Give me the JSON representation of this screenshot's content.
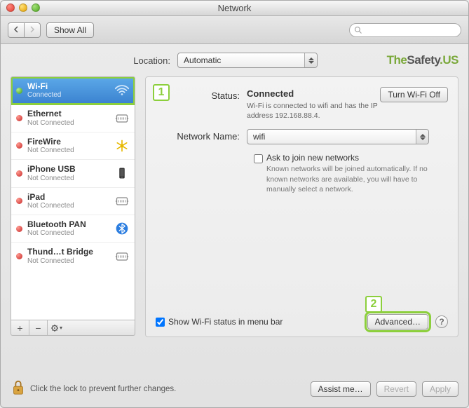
{
  "window": {
    "title": "Network"
  },
  "toolbar": {
    "show_all": "Show All",
    "search_placeholder": ""
  },
  "brand": {
    "the": "The",
    "safety": "Safety",
    "us": ".US"
  },
  "location": {
    "label": "Location:",
    "value": "Automatic"
  },
  "sidebar": {
    "items": [
      {
        "name": "Wi-Fi",
        "status": "Connected",
        "dot": "green",
        "icon": "wifi",
        "selected": true
      },
      {
        "name": "Ethernet",
        "status": "Not Connected",
        "dot": "red",
        "icon": "ethernet"
      },
      {
        "name": "FireWire",
        "status": "Not Connected",
        "dot": "red",
        "icon": "firewire"
      },
      {
        "name": "iPhone USB",
        "status": "Not Connected",
        "dot": "red",
        "icon": "iphone"
      },
      {
        "name": "iPad",
        "status": "Not Connected",
        "dot": "red",
        "icon": "ethernet"
      },
      {
        "name": "Bluetooth PAN",
        "status": "Not Connected",
        "dot": "red",
        "icon": "bluetooth"
      },
      {
        "name": "Thund…t Bridge",
        "status": "Not Connected",
        "dot": "red",
        "icon": "ethernet"
      }
    ]
  },
  "steps": {
    "one": "1",
    "two": "2"
  },
  "pane": {
    "status_label": "Status:",
    "status_value": "Connected",
    "status_desc": "Wi-Fi is connected to wifi and has the IP address 192.168.88.4.",
    "turn_off": "Turn Wi-Fi Off",
    "network_name_label": "Network Name:",
    "network_name_value": "wifi",
    "ask_join_label": "Ask to join new networks",
    "ask_join_desc": "Known networks will be joined automatically. If no known networks are available, you will have to manually select a network.",
    "show_status_label": "Show Wi-Fi status in menu bar",
    "advanced": "Advanced…",
    "help": "?"
  },
  "footer": {
    "lock_text": "Click the lock to prevent further changes.",
    "assist": "Assist me…",
    "revert": "Revert",
    "apply": "Apply"
  },
  "list_toolbar": {
    "add": "+",
    "remove": "−",
    "gear": "✻▾"
  }
}
